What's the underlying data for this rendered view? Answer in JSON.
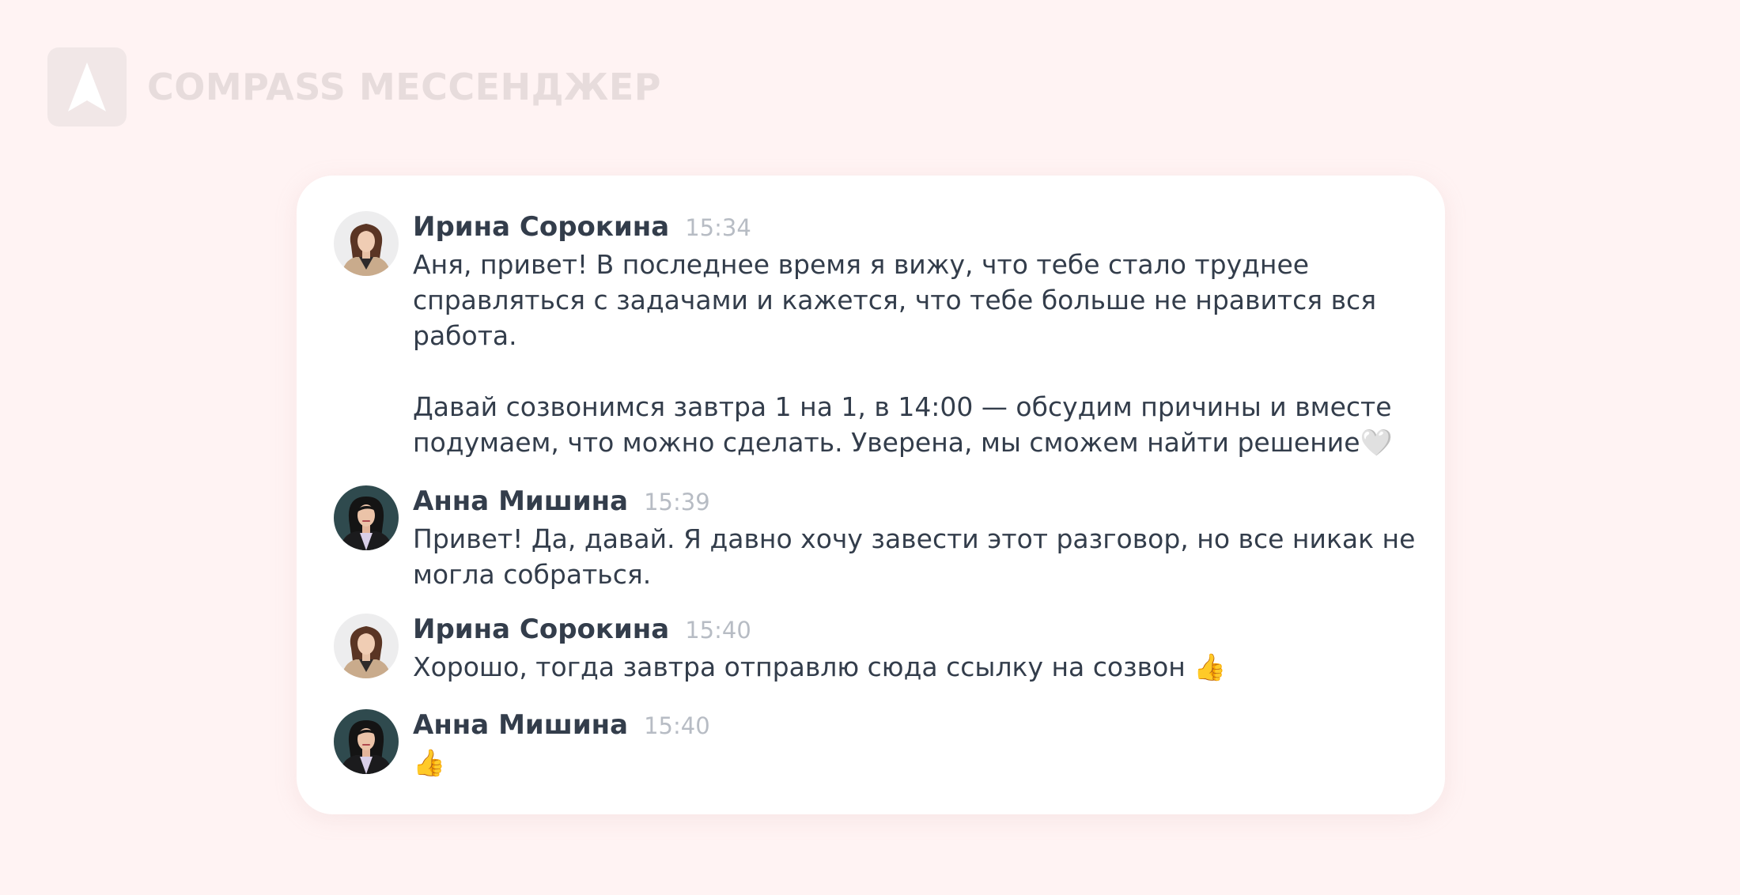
{
  "brand": {
    "name": "COMPASS МЕССЕНДЖЕР",
    "logo_icon": "compass-arrow-icon"
  },
  "colors": {
    "background": "#fff3f3",
    "card": "#ffffff",
    "author_text": "#333d4b",
    "time_text": "#b7bcc4",
    "brand_faded": "#e7dcdc"
  },
  "messages": [
    {
      "author": "Ирина Сорокина",
      "time": "15:34",
      "avatar": "irina-avatar",
      "text": "Аня, привет! В последнее время я вижу, что тебе стало труднее справляться с задачами и кажется, что тебе больше не нравится вся работа.\n\nДавай созвонимся завтра 1 на 1, в 14:00 — обсудим причины и вместе подумаем, что можно сделать. Уверена, мы сможем найти решение🤍"
    },
    {
      "author": "Анна Мишина",
      "time": "15:39",
      "avatar": "anna-avatar",
      "text": "Привет! Да, давай. Я давно хочу завести этот разговор, но все никак не могла собраться."
    },
    {
      "author": "Ирина Сорокина",
      "time": "15:40",
      "avatar": "irina-avatar",
      "text": "Хорошо, тогда завтра отправлю сюда ссылку на созвон 👍"
    },
    {
      "author": "Анна Мишина",
      "time": "15:40",
      "avatar": "anna-avatar",
      "text": "👍"
    }
  ]
}
